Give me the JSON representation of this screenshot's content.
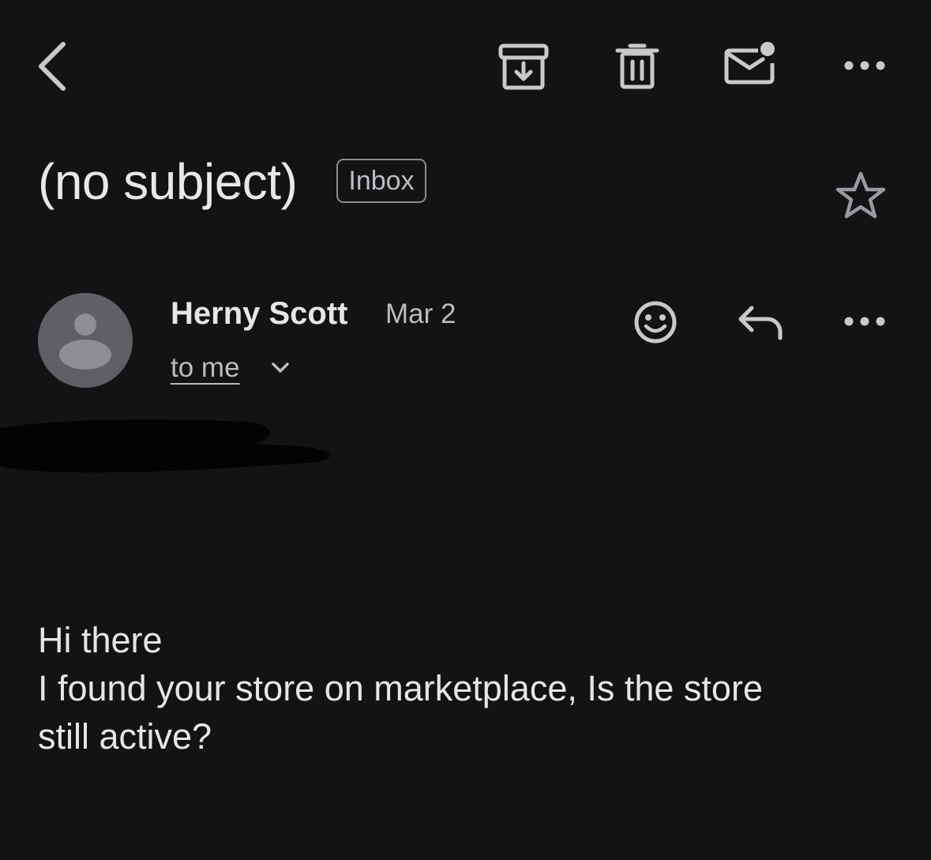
{
  "toolbar": {
    "back": "chevron-left-icon",
    "archive": "archive-icon",
    "delete": "trash-icon",
    "mark_unread": "mark-unread-icon",
    "more": "more-horizontal-icon"
  },
  "email": {
    "subject": "(no subject)",
    "label": "Inbox",
    "starred": false,
    "sender": {
      "name": "Herny Scott",
      "date": "Mar 2",
      "recipient": "to me",
      "avatar": "person-avatar-icon"
    },
    "body": {
      "lines": [
        "Hi there",
        "I found your store on marketplace, Is the store",
        "still active?"
      ]
    }
  },
  "colors": {
    "background": "#131316",
    "text": "#e6e6e6",
    "secondary_text": "#bcbcbf",
    "icon": "#c9c9cc",
    "badge_border": "#8b8b8f",
    "avatar_bg": "#5f6063"
  }
}
